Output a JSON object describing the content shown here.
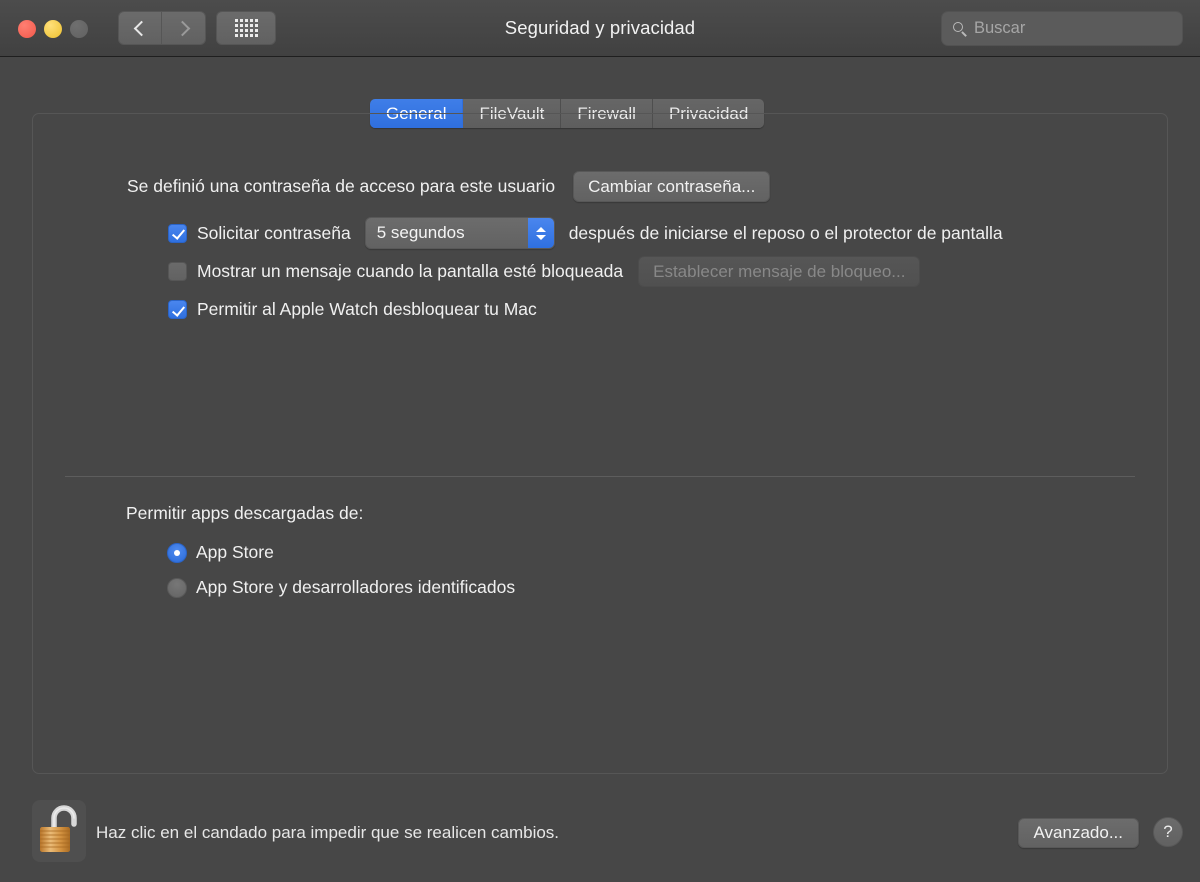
{
  "window": {
    "title": "Seguridad y privacidad",
    "traffic_lights": [
      "close",
      "minimize",
      "zoom"
    ],
    "nav": {
      "back_icon": "chevron-left-icon",
      "forward_icon": "chevron-right-icon",
      "grid_icon": "grid-view-icon"
    }
  },
  "search": {
    "placeholder": "Buscar",
    "value": "",
    "icon": "search-icon"
  },
  "tabs": [
    {
      "label": "General",
      "active": true
    },
    {
      "label": "FileVault",
      "active": false
    },
    {
      "label": "Firewall",
      "active": false
    },
    {
      "label": "Privacidad",
      "active": false
    }
  ],
  "general": {
    "password_set_label": "Se definió una contraseña de acceso para este usuario",
    "change_password_button": "Cambiar contraseña...",
    "require_password": {
      "checked": true,
      "label": "Solicitar contraseña",
      "delay_value": "5 segundos",
      "suffix_label": "después de iniciarse el reposo o el protector de pantalla"
    },
    "show_message": {
      "checked": false,
      "label": "Mostrar un mensaje cuando la pantalla esté bloqueada",
      "set_message_button": "Establecer mensaje de bloqueo...",
      "button_disabled": true
    },
    "apple_watch": {
      "checked": true,
      "label": "Permitir al Apple Watch desbloquear tu Mac"
    },
    "allow_apps": {
      "heading": "Permitir apps descargadas de:",
      "options": [
        {
          "label": "App Store",
          "selected": true
        },
        {
          "label": "App Store y desarrolladores identificados",
          "selected": false
        }
      ]
    }
  },
  "footer": {
    "lock_icon": "unlocked-padlock-icon",
    "lock_text": "Haz clic en el candado para impedir que se realicen cambios.",
    "advanced_button": "Avanzado...",
    "help_button": "?"
  },
  "colors": {
    "accent_blue": "#2f70e0",
    "window_bg": "#474747",
    "titlebar_bg": "#454545",
    "text": "#f0f0f0",
    "lock_gold": "#d6973f"
  }
}
